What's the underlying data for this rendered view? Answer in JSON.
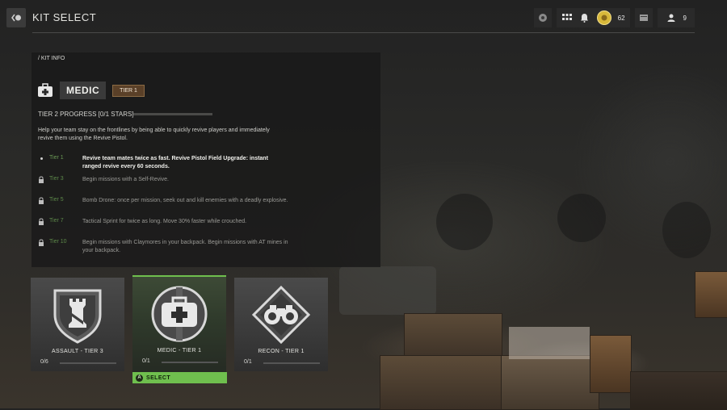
{
  "header": {
    "back_button_glyph": "B",
    "title": "KIT SELECT",
    "status": {
      "currency_value": "62",
      "party_count": "9"
    }
  },
  "kit_info": {
    "breadcrumb": "/ KIT INFO",
    "name": "MEDIC",
    "tier_badge": "TIER 1",
    "progress_label": "TIER 2 PROGRESS [0/1 STARS]",
    "progress_fraction": 0.0,
    "description": "Help your team stay on the frontlines by being able to quickly revive players and immediately revive them using the Revive Pistol.",
    "tiers": [
      {
        "name": "Tier 1",
        "desc": "Revive team mates twice as fast. Revive Pistol Field Upgrade: instant ranged revive every 60 seconds.",
        "unlocked": true
      },
      {
        "name": "Tier 3",
        "desc": "Begin missions with a Self-Revive.",
        "unlocked": false
      },
      {
        "name": "Tier 5",
        "desc": "Bomb Drone: once per mission, seek out and kill enemies with a deadly explosive.",
        "unlocked": false
      },
      {
        "name": "Tier 7",
        "desc": "Tactical Sprint for twice as long. Move 30% faster while crouched.",
        "unlocked": false
      },
      {
        "name": "Tier 10",
        "desc": "Begin missions with Claymores in your backpack. Begin missions with AT mines in your backpack.",
        "unlocked": false
      }
    ]
  },
  "cards": [
    {
      "label": "ASSAULT - TIER 3",
      "progress": "0/6",
      "emblem": "rook-shield-icon",
      "selected": false
    },
    {
      "label": "MEDIC - TIER 1",
      "progress": "0/1",
      "emblem": "medkit-icon",
      "selected": true
    },
    {
      "label": "RECON - TIER 1",
      "progress": "0/1",
      "emblem": "binoculars-icon",
      "selected": false
    }
  ],
  "select_button": {
    "glyph": "A",
    "label": "SELECT"
  },
  "accent_color": "#6fbf4e",
  "tier_badge_color": "#5a4028"
}
